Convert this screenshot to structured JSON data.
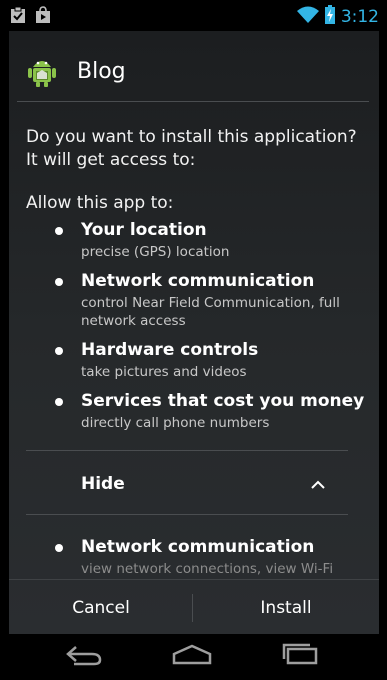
{
  "status_bar": {
    "time": "3:12",
    "icons": [
      "clipboard-check-icon",
      "shopping-bag-icon",
      "wifi-icon",
      "battery-charging-icon"
    ],
    "accent_color": "#33b5e5"
  },
  "dialog": {
    "app_title": "Blog",
    "app_icon": "android-robot-icon",
    "question": "Do you want to install this application? It will get access to:",
    "allow_heading": "Allow this app to:",
    "permissions": [
      {
        "title": "Your location",
        "description": "precise (GPS) location"
      },
      {
        "title": "Network communication",
        "description": "control Near Field Communication, full network access"
      },
      {
        "title": "Hardware controls",
        "description": "take pictures and videos"
      },
      {
        "title": "Services that cost you money",
        "description": "directly call phone numbers"
      }
    ],
    "hide_label": "Hide",
    "hidden_permissions": [
      {
        "title": "Network communication",
        "description": "view network connections, view Wi-Fi"
      }
    ],
    "buttons": {
      "cancel": "Cancel",
      "install": "Install"
    }
  },
  "nav_bar": {
    "icons": [
      "back-icon",
      "home-icon",
      "recent-apps-icon"
    ]
  }
}
